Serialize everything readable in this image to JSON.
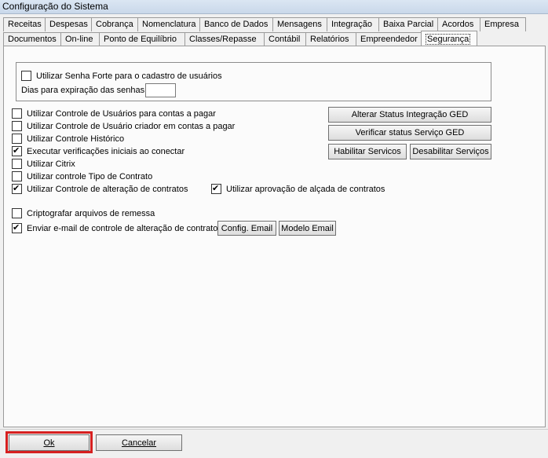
{
  "window": {
    "title": "Configuração do Sistema"
  },
  "tabs_row1": [
    "Receitas",
    "Despesas",
    "Cobrança",
    "Nomenclatura",
    "Banco de Dados",
    "Mensagens",
    "Integração",
    "Baixa Parcial",
    "Acordos",
    "Empresa"
  ],
  "tabs_row2": [
    "Documentos",
    "On-line",
    "Ponto de Equilíbrio",
    "Classes/Repasse",
    "Contábil",
    "Relatórios",
    "Empreendedor",
    "Segurança"
  ],
  "active_tab": "Segurança",
  "security": {
    "strong_password": {
      "label": "Utilizar Senha Forte para o cadastro de usuários",
      "checked": false
    },
    "expiry_label": "Dias para expiração das senhas:",
    "expiry_value": "",
    "options": [
      {
        "label": "Utilizar Controle de Usuários para contas a pagar",
        "checked": false
      },
      {
        "label": "Utilizar Controle de Usuário criador em contas a pagar",
        "checked": false
      },
      {
        "label": "Utilizar Controle Histórico",
        "checked": false
      },
      {
        "label": "Executar verificações iniciais ao conectar",
        "checked": true
      },
      {
        "label": "Utilizar Citrix",
        "checked": false
      },
      {
        "label": "Utilizar controle Tipo de Contrato",
        "checked": false
      },
      {
        "label": "Utilizar Controle de alteração de contratos",
        "checked": true
      }
    ],
    "approval": {
      "label": "Utilizar aprovação de alçada de contratos",
      "checked": true
    },
    "encrypt": {
      "label": "Criptografar arquivos de remessa",
      "checked": false
    },
    "email": {
      "label": "Enviar e-mail de controle de alteração de contratos",
      "checked": true
    },
    "buttons": {
      "alter_status": "Alterar Status Integração GED",
      "verify_status": "Verificar status Serviço GED",
      "enable_services": "Habilitar Servicos",
      "disable_services": "Desabilitar Serviços",
      "config_email": "Config. Email",
      "model_email": "Modelo Email"
    }
  },
  "footer": {
    "ok": "Ok",
    "cancel": "Cancelar"
  }
}
